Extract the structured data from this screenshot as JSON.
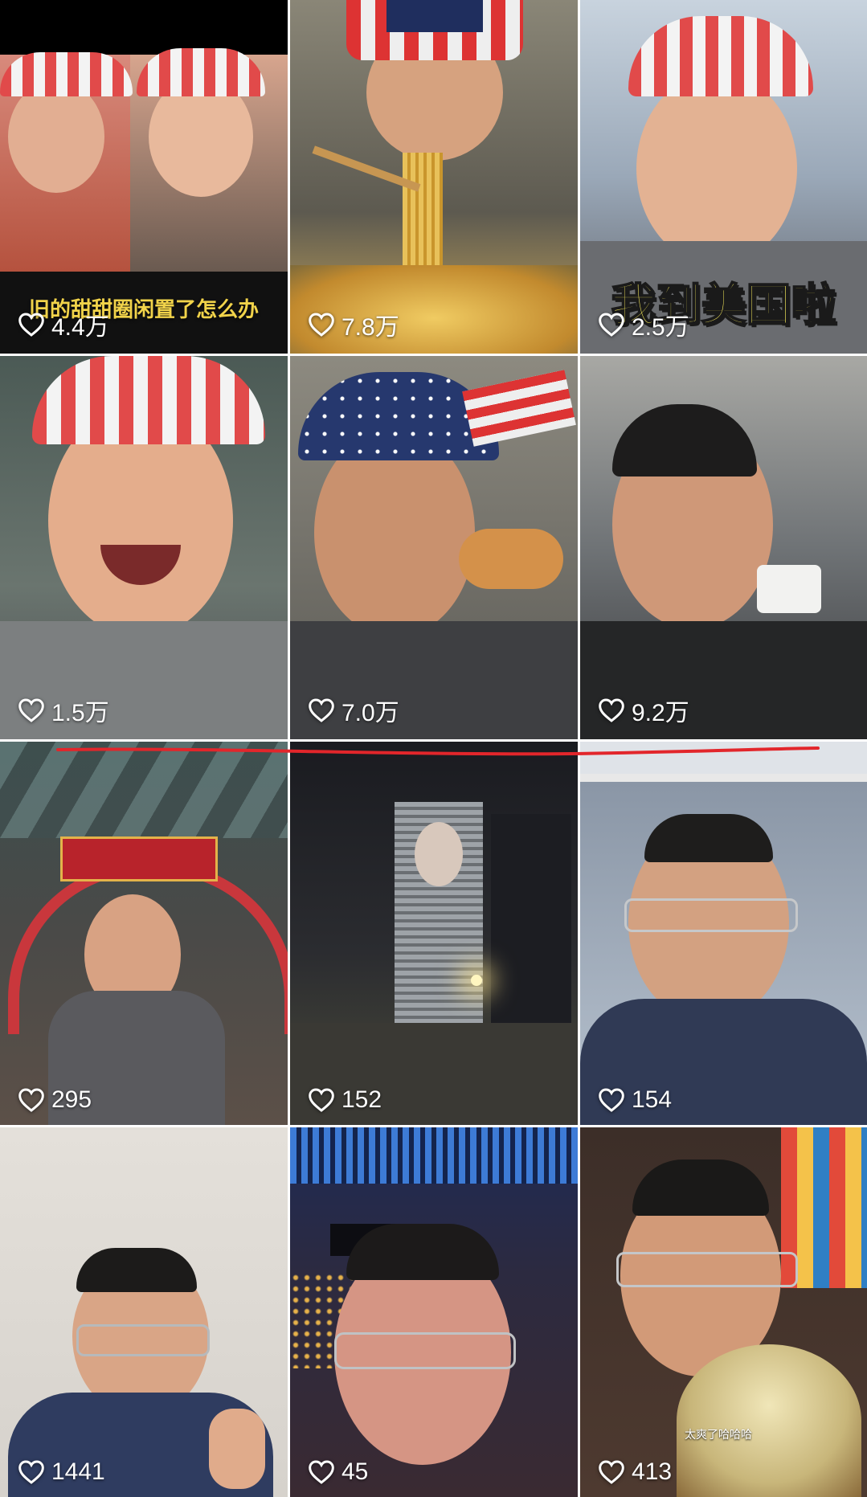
{
  "grid": {
    "tiles": [
      {
        "likes": "4.4万",
        "caption": "旧的甜甜圈闲置了怎么办",
        "bg": "#6a4a3c"
      },
      {
        "likes": "7.8万",
        "bg": "#7a6a55"
      },
      {
        "likes": "2.5万",
        "caption": "我到美国啦",
        "bg": "#9aa8b8"
      },
      {
        "likes": "1.5万",
        "bg": "#5a6660"
      },
      {
        "likes": "7.0万",
        "bg": "#6b6a63"
      },
      {
        "likes": "9.2万",
        "bg": "#6f7376"
      },
      {
        "likes": "295",
        "bg": "#4a4a48"
      },
      {
        "likes": "152",
        "bg": "#2b2c30"
      },
      {
        "likes": "154",
        "bg": "#8a96a6"
      },
      {
        "likes": "1441",
        "bg": "#d6d2cc"
      },
      {
        "likes": "45",
        "bg": "#2c2a40"
      },
      {
        "likes": "413",
        "subtitle": "太爽了哈哈哈",
        "bg": "#4e3a30"
      }
    ]
  },
  "colors": {
    "like_icon": "#ffffff",
    "caption_yellow": "#f1d34a",
    "annotation_line": "#e2262b"
  },
  "icons": {
    "like": "heart-outline-icon"
  }
}
